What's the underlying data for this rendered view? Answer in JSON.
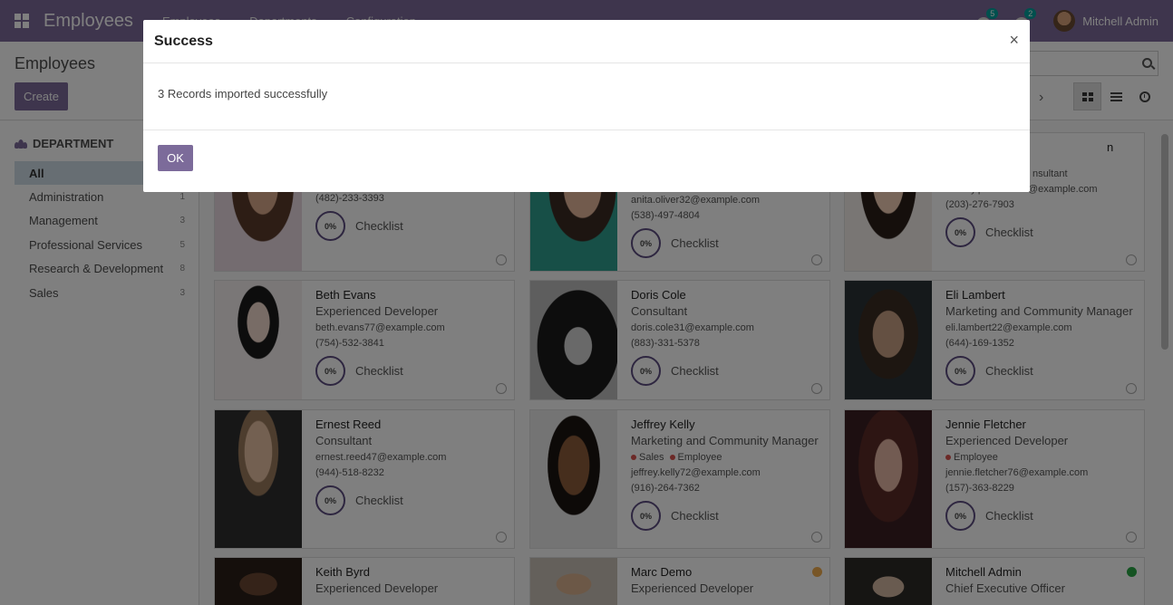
{
  "navbar": {
    "app_title": "Employees",
    "menu": [
      "Employees",
      "Departments",
      "Configuration"
    ],
    "messages_badge": "5",
    "activities_badge": "2",
    "user_name": "Mitchell Admin"
  },
  "control_panel": {
    "breadcrumb": "Employees",
    "create_label": "Create"
  },
  "sidebar": {
    "header": "DEPARTMENT",
    "items": [
      {
        "label": "All",
        "count": ""
      },
      {
        "label": "Administration",
        "count": "1"
      },
      {
        "label": "Management",
        "count": "3"
      },
      {
        "label": "Professional Services",
        "count": "5"
      },
      {
        "label": "Research & Development",
        "count": "8"
      },
      {
        "label": "Sales",
        "count": "3"
      }
    ]
  },
  "cards": [
    {
      "name": "",
      "job": "",
      "email": "",
      "phone": "(482)-233-3393",
      "progress": "0%",
      "checklist": "Checklist"
    },
    {
      "name": "",
      "job": "",
      "email": "anita.oliver32@example.com",
      "phone": "(538)-497-4804",
      "progress": "0%",
      "checklist": "Checklist"
    },
    {
      "name": "",
      "job": "",
      "job_fragment": "nsultant",
      "email": "audrey.peterson25@example.com",
      "phone": "(203)-276-7903",
      "progress": "0%",
      "checklist": "Checklist",
      "name_fragment": "n"
    },
    {
      "name": "Beth Evans",
      "job": "Experienced Developer",
      "email": "beth.evans77@example.com",
      "phone": "(754)-532-3841",
      "progress": "0%",
      "checklist": "Checklist"
    },
    {
      "name": "Doris Cole",
      "job": "Consultant",
      "email": "doris.cole31@example.com",
      "phone": "(883)-331-5378",
      "progress": "0%",
      "checklist": "Checklist"
    },
    {
      "name": "Eli Lambert",
      "job": "Marketing and Community Manager",
      "email": "eli.lambert22@example.com",
      "phone": "(644)-169-1352",
      "progress": "0%",
      "checklist": "Checklist"
    },
    {
      "name": "Ernest Reed",
      "job": "Consultant",
      "email": "ernest.reed47@example.com",
      "phone": "(944)-518-8232",
      "progress": "0%",
      "checklist": "Checklist"
    },
    {
      "name": "Jeffrey Kelly",
      "job": "Marketing and Community Manager",
      "tags": [
        "Sales",
        "Employee"
      ],
      "email": "jeffrey.kelly72@example.com",
      "phone": "(916)-264-7362",
      "progress": "0%",
      "checklist": "Checklist"
    },
    {
      "name": "Jennie Fletcher",
      "job": "Experienced Developer",
      "tags": [
        "Employee"
      ],
      "email": "jennie.fletcher76@example.com",
      "phone": "(157)-363-8229",
      "progress": "0%",
      "checklist": "Checklist"
    },
    {
      "name": "Keith Byrd",
      "job": "Experienced Developer"
    },
    {
      "name": "Marc Demo",
      "job": "Experienced Developer"
    },
    {
      "name": "Mitchell Admin",
      "job": "Chief Executive Officer"
    }
  ],
  "colors": {
    "brand": "#7c6b9a",
    "status_away": "#f0ad4e",
    "status_online": "#28a745",
    "tag": "#d9534f"
  },
  "modal": {
    "title": "Success",
    "close": "×",
    "message": "3 Records imported successfully",
    "ok_label": "OK"
  }
}
